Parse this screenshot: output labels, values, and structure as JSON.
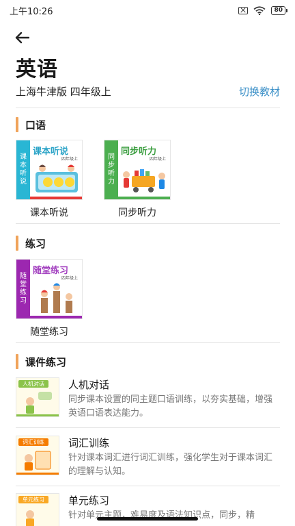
{
  "status_bar": {
    "time": "上午10:26",
    "battery": "80"
  },
  "header": {
    "title": "英语",
    "edition": "上海牛津版 四年级上",
    "switch_label": "切换教材"
  },
  "sections": {
    "speaking": {
      "title": "口语",
      "books": [
        {
          "spine": [
            "课",
            "本",
            "听",
            "说"
          ],
          "cover_title": "课本听说",
          "grade": "四年级上",
          "label": "课本听说",
          "color": "#29b6d4",
          "foot": "#e53935"
        },
        {
          "spine": [
            "同",
            "步",
            "听",
            "力"
          ],
          "cover_title": "同步听力",
          "grade": "四年级上",
          "label": "同步听力",
          "color": "#4caf50",
          "foot": "#4caf50"
        }
      ]
    },
    "practice": {
      "title": "练习",
      "books": [
        {
          "spine": [
            "随",
            "堂",
            "练",
            "习"
          ],
          "cover_title": "随堂练习",
          "grade": "四年级上",
          "label": "随堂练习",
          "color": "#9c27b0",
          "foot": "#9c27b0"
        }
      ]
    },
    "courseware": {
      "title": "课件练习",
      "items": [
        {
          "thumb_title": "人机对话",
          "thumb_color": "#8bc34a",
          "name": "人机对话",
          "desc": "同步课本设置的同主题口语训练，以夯实基础，增强英语口语表达能力。"
        },
        {
          "thumb_title": "词汇训练",
          "thumb_color": "#f57c00",
          "name": "词汇训练",
          "desc": "针对课本词汇进行词汇训练，强化学生对于课本词汇的理解与认知。"
        },
        {
          "thumb_title": "单元练习",
          "thumb_color": "#f9a825",
          "name": "单元练习",
          "desc": "针对单元主题，难易度及语法知识点，同步，精"
        }
      ]
    }
  }
}
